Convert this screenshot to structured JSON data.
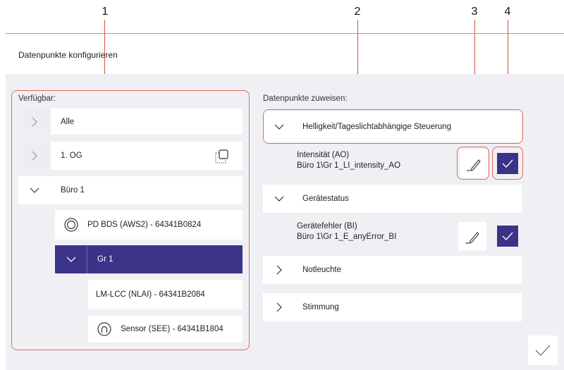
{
  "callouts": [
    "1",
    "2",
    "3",
    "4"
  ],
  "page_title": "Datenpunkte konfigurieren",
  "available": {
    "label": "Verfügbar:",
    "items": [
      {
        "label": "Alle",
        "icon": "chevron-right-icon"
      },
      {
        "label": "1. OG",
        "icon": "chevron-right-icon"
      },
      {
        "label": "Büro 1",
        "icon": "chevron-down-icon"
      },
      {
        "label": "PD BDS (AWS2) - 64341B0824",
        "icon": "presence-detector-icon"
      },
      {
        "label": "Gr 1",
        "icon": "chevron-down-icon"
      },
      {
        "label": "LM-LCC (NLAI) - 64341B2084"
      },
      {
        "label": "Sensor (SEE) - 64341B1804",
        "icon": "sensor-icon"
      }
    ]
  },
  "assign": {
    "label": "Datenpunkte zuweisen:",
    "groups": [
      {
        "label": "Helligkeit/Tageslichtabhängige Steuerung",
        "icon": "chevron-down-icon"
      },
      {
        "label": "Gerätestatus",
        "icon": "chevron-down-icon"
      },
      {
        "label": "Notleuchte",
        "icon": "chevron-right-icon"
      },
      {
        "label": "Stimmung",
        "icon": "chevron-right-icon"
      }
    ],
    "datapoints": [
      {
        "name": "Intensität (AO)",
        "path": "Büro 1\\Gr 1_LI_intensity_AO"
      },
      {
        "name": "Gerätefehler (BI)",
        "path": "Büro 1\\Gr 1_E_anyError_BI"
      }
    ]
  },
  "colors": {
    "accent": "#3a3388",
    "highlight": "#e06a5a",
    "panel": "#f0f0f4"
  }
}
